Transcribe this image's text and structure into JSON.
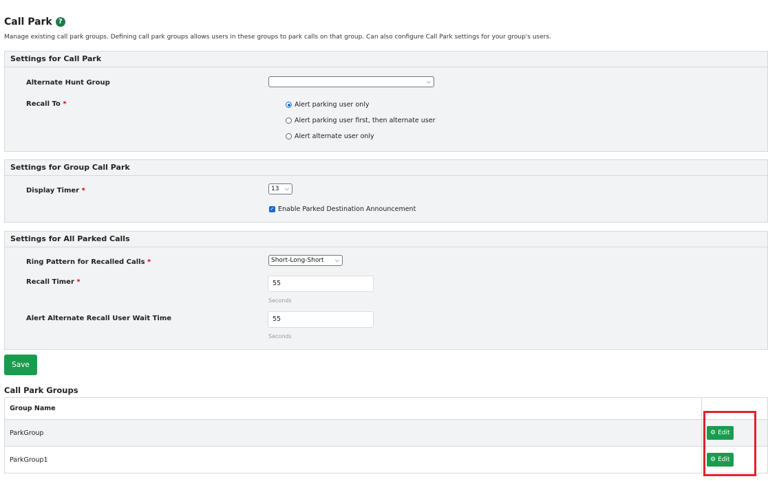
{
  "header": {
    "title": "Call Park",
    "description": "Manage existing call park groups. Defining call park groups allows users in these groups to park calls on that group. Can also configure Call Park settings for your group's users."
  },
  "call_park_settings": {
    "header": "Settings for Call Park",
    "alternate_hunt_group": {
      "label": "Alternate Hunt Group",
      "value": ""
    },
    "recall_to": {
      "label": "Recall To",
      "required_mark": "*",
      "options": [
        {
          "label": "Alert parking user only",
          "selected": true
        },
        {
          "label": "Alert parking user first, then alternate user",
          "selected": false
        },
        {
          "label": "Alert alternate user only",
          "selected": false
        }
      ]
    }
  },
  "group_call_park_settings": {
    "header": "Settings for Group Call Park",
    "display_timer": {
      "label": "Display Timer",
      "required_mark": "*",
      "value": "13"
    },
    "announcement": {
      "label": "Enable Parked Destination Announcement",
      "checked": true
    }
  },
  "all_parked_calls_settings": {
    "header": "Settings for All Parked Calls",
    "ring_pattern": {
      "label": "Ring Pattern for Recalled Calls",
      "required_mark": "*",
      "value": "Short-Long-Short"
    },
    "recall_timer": {
      "label": "Recall Timer",
      "required_mark": "*",
      "value": "55",
      "unit": "Seconds"
    },
    "alternate_wait_time": {
      "label": "Alert Alternate Recall User Wait Time",
      "value": "55",
      "unit": "Seconds"
    }
  },
  "actions": {
    "save_label": "Save"
  },
  "call_park_groups": {
    "title": "Call Park Groups",
    "column_header": "Group Name",
    "rows": [
      {
        "name": "ParkGroup",
        "edit_label": "Edit"
      },
      {
        "name": "ParkGroup1",
        "edit_label": "Edit"
      }
    ]
  },
  "colors": {
    "accent_green": "#1a9c4e",
    "highlight_red": "#e0202e",
    "section_background": "#f2f3f4"
  },
  "icons": {
    "help": "help-icon",
    "edit": "gears-icon",
    "select": "chevron-down-icon"
  }
}
